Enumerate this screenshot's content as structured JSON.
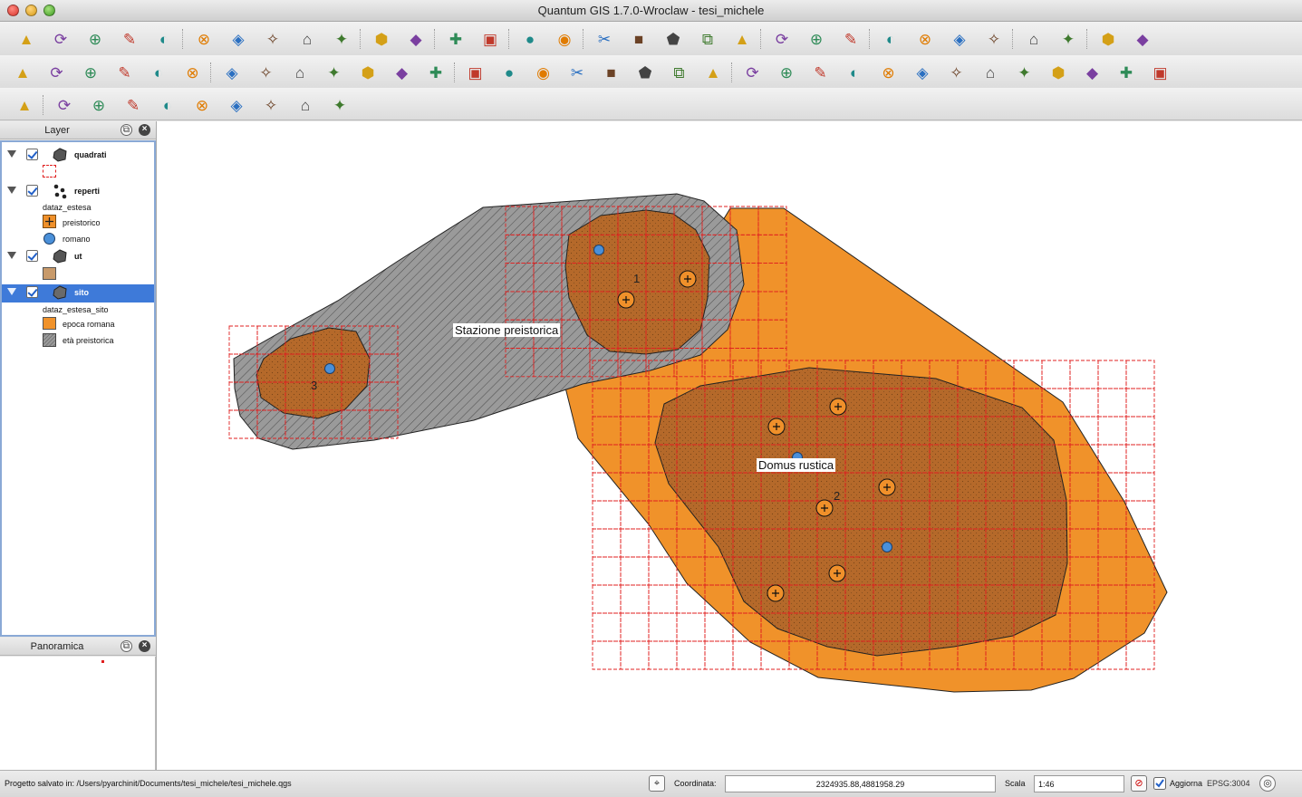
{
  "window": {
    "title": "Quantum GIS 1.7.0-Wroclaw - tesi_michele"
  },
  "toolbar_icons": {
    "row1": [
      "add-layer",
      "db",
      "feature",
      "vector-attr",
      "pen",
      "buffer",
      "ruler-figure",
      "gender",
      "people",
      "compass",
      "globe",
      "refresh",
      "camera",
      "gps",
      "info-globe",
      "help-cursor",
      "select",
      "deselect",
      "attribute-table",
      "measure",
      "map-tips",
      "bookmark-new",
      "bookmark-home",
      "new-bookmark",
      "spellcheck",
      "georef",
      "measure-2",
      "processing",
      "database",
      "raster-tool",
      "grass",
      "graph"
    ],
    "row2": [
      "new-project",
      "open-project",
      "save-project",
      "save-as",
      "new-print-composer",
      "print",
      "add-vector",
      "add-raster",
      "add-postgis",
      "add-spatialite",
      "add-wms",
      "new-shapefile",
      "remove-layer",
      "toggle-editing",
      "save-edits",
      "move-feature",
      "node-tool",
      "delete-selected",
      "cut",
      "copy",
      "paste",
      "undo",
      "redo",
      "add-ring",
      "add-part",
      "simplify",
      "delete-ring",
      "delete-part",
      "reshape",
      "split",
      "merge",
      "rotate",
      "offset",
      "whats-this"
    ],
    "row3": [
      "pan",
      "zoom-in",
      "zoom-out",
      "zoom-full",
      "zoom-selection",
      "zoom-layer",
      "zoom-actual",
      "zoom-last",
      "zoom-next",
      "refresh"
    ]
  },
  "layer_panel": {
    "title": "Layer",
    "layers": [
      {
        "name": "quadrati",
        "checked": true
      },
      {
        "name": "reperti",
        "checked": true,
        "field": "dataz_estesa",
        "classes": [
          {
            "label": "preistorico",
            "color": "#f0902a"
          },
          {
            "label": "romano",
            "color": "#4a90d9"
          }
        ]
      },
      {
        "name": "ut",
        "checked": true
      },
      {
        "name": "sito",
        "checked": true,
        "selected": true,
        "field": "dataz_estesa_sito",
        "classes": [
          {
            "label": "epoca romana",
            "color": "#f0922a"
          },
          {
            "label": "età preistorica",
            "color": "#9a9a9a"
          }
        ]
      }
    ]
  },
  "overview_panel": {
    "title": "Panoramica"
  },
  "map": {
    "labels": {
      "stazione": "Stazione preistorica",
      "domus": "Domus rustica"
    },
    "ut_numbers": [
      "1",
      "2",
      "3"
    ],
    "colors": {
      "roman": "#f0922a",
      "prehistoric": "#9a9a9a",
      "ut_fill": "#b5692a",
      "grid": "#e02020",
      "find_roman": "#4a90d9"
    }
  },
  "status": {
    "message": "Progetto salvato in: /Users/pyarchinit/Documents/tesi_michele/tesi_michele.qgs",
    "coord_label": "Coordinata:",
    "coord_value": "2324935.88,4881958.29",
    "scale_label": "Scala",
    "scale_value": "1:46",
    "render_label": "Aggiorna",
    "render_checked": true,
    "crs": "EPSG:3004"
  }
}
